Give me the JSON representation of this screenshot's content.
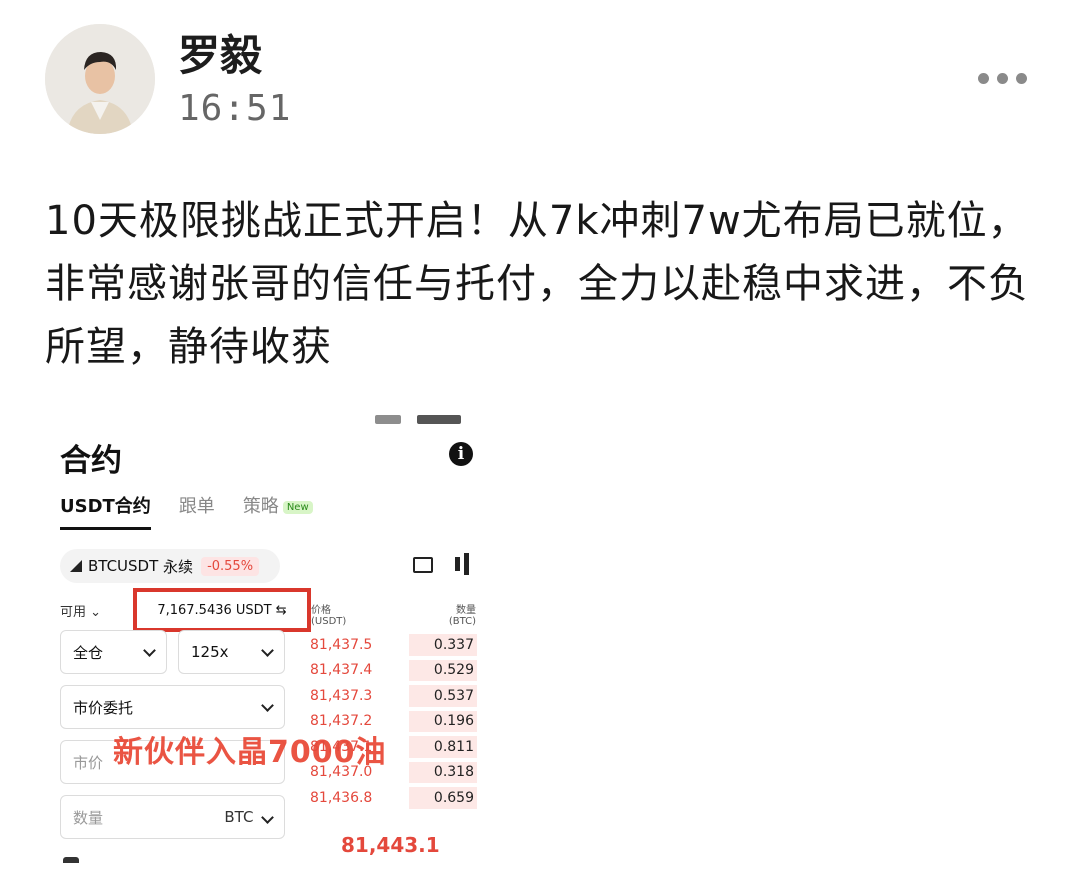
{
  "post": {
    "author": "罗毅",
    "time": "16:51",
    "text": "10天极限挑战正式开启！从7k冲刺7w尤布局已就位，非常感谢张哥的信任与托付，全力以赴稳中求进，不负所望，静待收获"
  },
  "screenshot": {
    "title": "合约",
    "tabs": [
      {
        "label": "USDT合约",
        "active": true
      },
      {
        "label": "跟单",
        "active": false
      },
      {
        "label": "策略",
        "active": false,
        "badge": "New"
      }
    ],
    "pair": {
      "symbol": "BTCUSDT",
      "type": "永续",
      "change": "-0.55%"
    },
    "available_label": "可用",
    "balance": "7,167.5436 USDT",
    "orderbook_header": {
      "price": "价格\n(USDT)",
      "qty": "数量\n(BTC)"
    },
    "margin_mode": "全仓",
    "leverage": "125x",
    "order_type": "市价委托",
    "price_placeholder": "市价",
    "qty_placeholder": "数量",
    "qty_unit": "BTC",
    "orderbook": [
      {
        "price": "81,437.5",
        "qty": "0.337",
        "depth": 0.4
      },
      {
        "price": "81,437.4",
        "qty": "0.529",
        "depth": 0.4
      },
      {
        "price": "81,437.3",
        "qty": "0.537",
        "depth": 0.4
      },
      {
        "price": "81,437.2",
        "qty": "0.196",
        "depth": 0.4
      },
      {
        "price": "81,437.1",
        "qty": "0.811",
        "depth": 0.4
      },
      {
        "price": "81,437.0",
        "qty": "0.318",
        "depth": 0.4
      },
      {
        "price": "81,436.8",
        "qty": "0.659",
        "depth": 0.4
      }
    ],
    "last_price": "81,443.1",
    "watermark": "新伙伴入晶7000油"
  },
  "colors": {
    "accent_red": "#e4483c",
    "highlight_box": "#d9372c"
  }
}
